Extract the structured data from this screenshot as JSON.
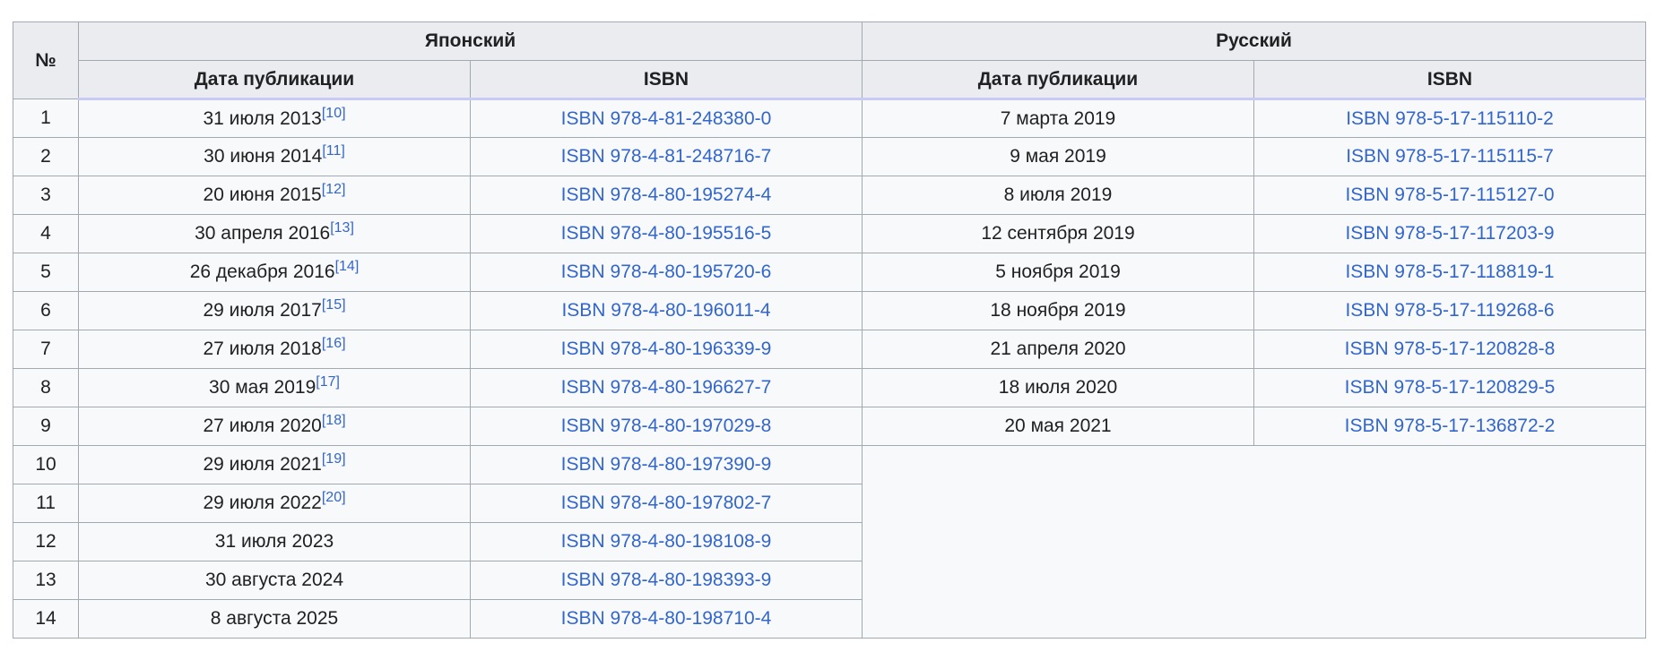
{
  "header": {
    "num": "№",
    "japanese": "Японский",
    "russian": "Русский",
    "pub_date": "Дата публикации",
    "isbn": "ISBN"
  },
  "rows": [
    {
      "num": "1",
      "jp_date": "31 июля 2013",
      "jp_ref": "[10]",
      "jp_isbn": "ISBN 978-4-81-248380-0",
      "ru_date": "7 марта 2019",
      "ru_isbn": "ISBN 978-5-17-115110-2"
    },
    {
      "num": "2",
      "jp_date": "30 июня 2014",
      "jp_ref": "[11]",
      "jp_isbn": "ISBN 978-4-81-248716-7",
      "ru_date": "9 мая 2019",
      "ru_isbn": "ISBN 978-5-17-115115-7"
    },
    {
      "num": "3",
      "jp_date": "20 июня 2015",
      "jp_ref": "[12]",
      "jp_isbn": "ISBN 978-4-80-195274-4",
      "ru_date": "8 июля 2019",
      "ru_isbn": "ISBN 978-5-17-115127-0"
    },
    {
      "num": "4",
      "jp_date": "30 апреля 2016",
      "jp_ref": "[13]",
      "jp_isbn": "ISBN 978-4-80-195516-5",
      "ru_date": "12 сентября 2019",
      "ru_isbn": "ISBN 978-5-17-117203-9"
    },
    {
      "num": "5",
      "jp_date": "26 декабря 2016",
      "jp_ref": "[14]",
      "jp_isbn": "ISBN 978-4-80-195720-6",
      "ru_date": "5 ноября 2019",
      "ru_isbn": "ISBN 978-5-17-118819-1"
    },
    {
      "num": "6",
      "jp_date": "29 июля 2017",
      "jp_ref": "[15]",
      "jp_isbn": "ISBN 978-4-80-196011-4",
      "ru_date": "18 ноября 2019",
      "ru_isbn": "ISBN 978-5-17-119268-6"
    },
    {
      "num": "7",
      "jp_date": "27 июля 2018",
      "jp_ref": "[16]",
      "jp_isbn": "ISBN 978-4-80-196339-9",
      "ru_date": "21 апреля 2020",
      "ru_isbn": "ISBN 978-5-17-120828-8"
    },
    {
      "num": "8",
      "jp_date": "30 мая 2019",
      "jp_ref": "[17]",
      "jp_isbn": "ISBN 978-4-80-196627-7",
      "ru_date": "18 июля 2020",
      "ru_isbn": "ISBN 978-5-17-120829-5"
    },
    {
      "num": "9",
      "jp_date": "27 июля 2020",
      "jp_ref": "[18]",
      "jp_isbn": "ISBN 978-4-80-197029-8",
      "ru_date": "20 мая 2021",
      "ru_isbn": "ISBN 978-5-17-136872-2"
    },
    {
      "num": "10",
      "jp_date": "29 июля 2021",
      "jp_ref": "[19]",
      "jp_isbn": "ISBN 978-4-80-197390-9"
    },
    {
      "num": "11",
      "jp_date": "29 июля 2022",
      "jp_ref": "[20]",
      "jp_isbn": "ISBN 978-4-80-197802-7"
    },
    {
      "num": "12",
      "jp_date": "31 июля 2023",
      "jp_ref": "",
      "jp_isbn": "ISBN 978-4-80-198108-9"
    },
    {
      "num": "13",
      "jp_date": "30 августа 2024",
      "jp_ref": "",
      "jp_isbn": "ISBN 978-4-80-198393-9"
    },
    {
      "num": "14",
      "jp_date": "8 августа 2025",
      "jp_ref": "",
      "jp_isbn": "ISBN 978-4-80-198710-4"
    }
  ]
}
